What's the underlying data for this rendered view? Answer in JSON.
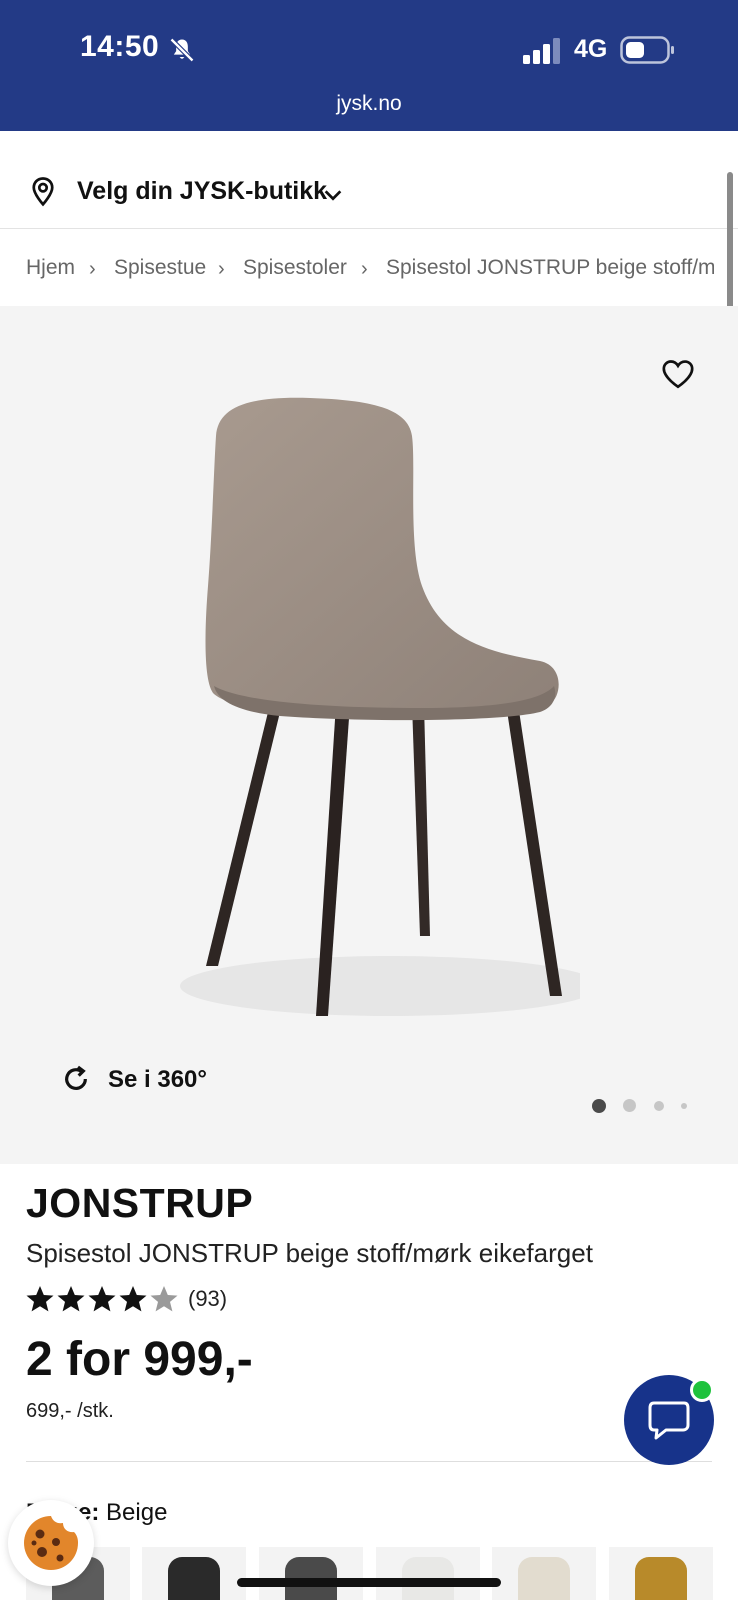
{
  "status_bar": {
    "time": "14:50",
    "network": "4G"
  },
  "browser": {
    "url": "jysk.no"
  },
  "store_picker": {
    "label": "Velg din JYSK-butikk"
  },
  "breadcrumb": [
    "Hjem",
    "Spisestue",
    "Spisestoler",
    "Spisestol JONSTRUP beige stoff/mørk eikefarget"
  ],
  "gallery": {
    "view_360_label": "Se i 360°",
    "image_count": 4,
    "active_index": 0
  },
  "product": {
    "brand": "JONSTRUP",
    "name": "Spisestol JONSTRUP beige stoff/mørk eikefarget",
    "rating": 4.7,
    "review_count": "(93)",
    "price": "2 for 999,-",
    "unit_price": "699,- /stk.",
    "color_label": "Farge:",
    "color_value": "Beige"
  },
  "swatches": [
    {
      "name": "Grå",
      "color": "#5c5c5c"
    },
    {
      "name": "Svart",
      "color": "#2a2a2a"
    },
    {
      "name": "Mørkegrå",
      "color": "#4a4a4a"
    },
    {
      "name": "Hvit",
      "color": "#e8e8e6"
    },
    {
      "name": "Teddy",
      "color": "#e2dccf"
    },
    {
      "name": "Sennep",
      "color": "#b88a2a"
    }
  ],
  "colors": {
    "brand_blue": "#233a86",
    "chat_blue": "#17338a",
    "online_green": "#1fc23d"
  }
}
